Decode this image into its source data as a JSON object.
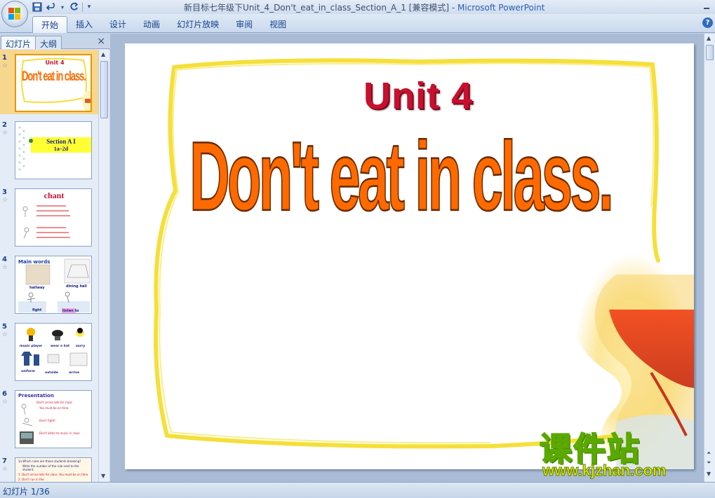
{
  "titlebar": {
    "title": "新目标七年级下Unit_4_Don't_eat_in_class_Section_A_1 [兼容模式] - ",
    "app_name": "Microsoft PowerPoint",
    "qat_icons": [
      "save-icon",
      "undo-icon",
      "redo-icon"
    ]
  },
  "ribbon": {
    "tabs": [
      "开始",
      "插入",
      "设计",
      "动画",
      "幻灯片放映",
      "审阅",
      "视图"
    ],
    "help": "?"
  },
  "pane": {
    "tabs": [
      "幻灯片",
      "大纲"
    ],
    "close": "×",
    "thumbs": [
      {
        "num": "1",
        "title": "Unit 4",
        "subtitle": "Don't eat in class."
      },
      {
        "num": "2",
        "title": "Section A I",
        "subtitle": "1a–2d"
      },
      {
        "num": "3",
        "title": "chant"
      },
      {
        "num": "4",
        "title": "Main words",
        "labels": [
          "hallway",
          "dining hall",
          "fight",
          "listen to"
        ]
      },
      {
        "num": "5",
        "labels": [
          "music player",
          "wear a hat",
          "sorry",
          "uniform",
          "outside",
          "arrive"
        ]
      },
      {
        "num": "6",
        "title": "Presentation",
        "lines": [
          "Don't arrive late for class.",
          "You must be on time.",
          "Don't fight!",
          "Don't listen to music in class."
        ]
      },
      {
        "num": "7",
        "lines": [
          "1a Which rules are these students breaking?",
          "Write the number of the rule next to the student.",
          "1. Don't arrive late for class. You must be on time.",
          "2. Don't run in the"
        ]
      }
    ]
  },
  "slide": {
    "title": "Unit 4",
    "subtitle": "Don't eat in class."
  },
  "status": {
    "text": "幻灯片 1/36"
  },
  "watermark": {
    "chinese": "课件站",
    "url": "www.kjzhan.com"
  },
  "colors": {
    "title_red": "#c8102e",
    "subtitle_orange": "#ff6a00",
    "frame_yellow": "#f5df3a",
    "accent_blue": "#15428b"
  }
}
